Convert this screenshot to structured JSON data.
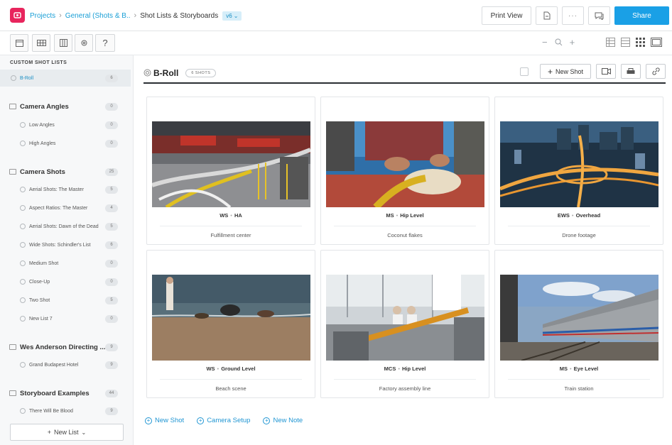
{
  "header": {
    "breadcrumbs": [
      "Projects",
      "General (Shots & B..",
      "Shot Lists & Storyboards"
    ],
    "version": "v6",
    "print_view": "Print View",
    "share": "Share"
  },
  "sidebar": {
    "section_title": "CUSTOM SHOT LISTS",
    "active_item": {
      "label": "B-Roll",
      "count": "6"
    },
    "groups": [
      {
        "label": "Camera Angles",
        "count": "0",
        "items": [
          {
            "label": "Low Angles",
            "count": "0"
          },
          {
            "label": "High Angles",
            "count": "0"
          }
        ]
      },
      {
        "label": "Camera Shots",
        "count": "25",
        "items": [
          {
            "label": "Aerial Shots: The Master",
            "count": "5"
          },
          {
            "label": "Aspect Ratios: The Master",
            "count": "4"
          },
          {
            "label": "Aerial Shots: Dawn of the Dead",
            "count": "5"
          },
          {
            "label": "Wide Shots: Schindler's List",
            "count": "6"
          },
          {
            "label": "Medium Shot",
            "count": "0"
          },
          {
            "label": "Close-Up",
            "count": "0"
          },
          {
            "label": "Two Shot",
            "count": "5"
          },
          {
            "label": "New List 7",
            "count": "0"
          }
        ]
      },
      {
        "label": "Wes Anderson Directing ...",
        "count": "9",
        "items": [
          {
            "label": "Grand Budapest Hotel",
            "count": "9"
          }
        ]
      },
      {
        "label": "Storyboard Examples",
        "count": "44",
        "items": [
          {
            "label": "There Will Be Blood",
            "count": "9"
          }
        ]
      }
    ],
    "new_list": "New List"
  },
  "main": {
    "title": "B-Roll",
    "shots_badge": "6 SHOTS",
    "new_shot": "New Shot",
    "cards": [
      {
        "size": "WS",
        "angle": "HA",
        "desc": "Fulfillment center"
      },
      {
        "size": "MS",
        "angle": "Hip Level",
        "desc": "Coconut flakes"
      },
      {
        "size": "EWS",
        "angle": "Overhead",
        "desc": "Drone footage"
      },
      {
        "size": "WS",
        "angle": "Ground Level",
        "desc": "Beach scene"
      },
      {
        "size": "MCS",
        "angle": "Hip Level",
        "desc": "Factory assembly line"
      },
      {
        "size": "MS",
        "angle": "Eye Level",
        "desc": "Train station"
      }
    ],
    "bottom_links": [
      "New Shot",
      "Camera Setup",
      "New Note"
    ]
  },
  "colors": {
    "accent": "#1aa0e6",
    "brand": "#e8255d",
    "link": "#2196d3"
  }
}
